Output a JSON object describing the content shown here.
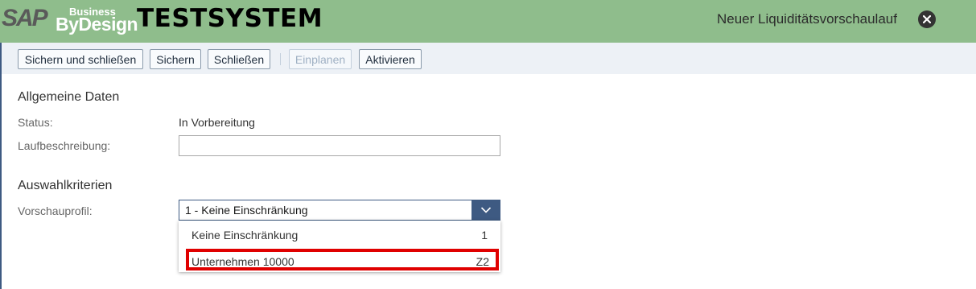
{
  "header": {
    "logo_sap": "SAP",
    "logo_business": "Business",
    "logo_bydesign": "ByDesign",
    "system_title": "TESTSYSTEM",
    "window_title": "Neuer Liquiditätsvorschaulauf",
    "close_icon": "close-icon",
    "background_color": "#8fbd8c"
  },
  "toolbar": {
    "save_close_label": "Sichern und schließen",
    "save_label": "Sichern",
    "close_label": "Schließen",
    "schedule_label": "Einplanen",
    "schedule_disabled": true,
    "activate_label": "Aktivieren"
  },
  "general": {
    "section_title": "Allgemeine Daten",
    "status_label": "Status:",
    "status_value": "In Vorbereitung",
    "description_label": "Laufbeschreibung:",
    "description_value": ""
  },
  "selection": {
    "section_title": "Auswahlkriterien",
    "profile_label": "Vorschauprofil:",
    "profile_value": "1 - Keine Einschränkung",
    "dropdown_icon": "chevron-down-icon",
    "options": [
      {
        "label": "Keine Einschränkung",
        "code": "1"
      },
      {
        "label": "Unternehmen 10000",
        "code": "Z2",
        "highlighted": true
      }
    ]
  },
  "colors": {
    "accent": "#3e5a82",
    "highlight_border": "#e00000"
  }
}
